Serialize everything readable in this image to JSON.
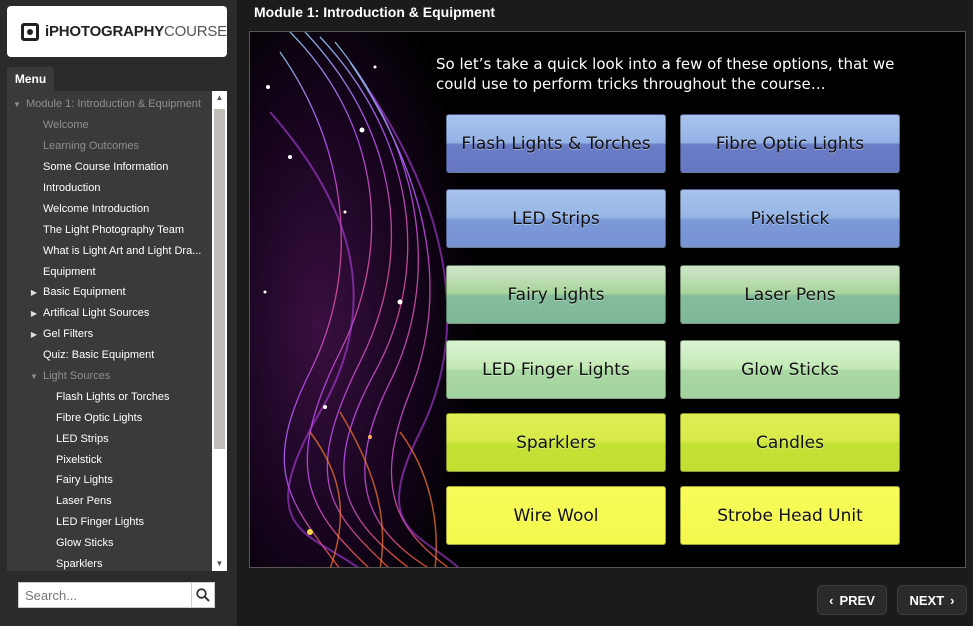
{
  "logo": {
    "bold": "iPHOTOGRAPHY",
    "light": "COURSE"
  },
  "menu": {
    "tab_label": "Menu",
    "items": [
      {
        "label": "Module 1: Introduction & Equipment",
        "level": "l0",
        "arrow": "down",
        "dim": true
      },
      {
        "label": "Welcome",
        "level": "l1",
        "dim": true
      },
      {
        "label": "Learning Outcomes",
        "level": "l1",
        "dim": true
      },
      {
        "label": "Some Course Information",
        "level": "l1"
      },
      {
        "label": "Introduction",
        "level": "l1"
      },
      {
        "label": "Welcome Introduction",
        "level": "l1"
      },
      {
        "label": "The Light Photography Team",
        "level": "l1"
      },
      {
        "label": "What is Light Art and Light Dra...",
        "level": "l1"
      },
      {
        "label": "Equipment",
        "level": "l1"
      },
      {
        "label": "Basic Equipment",
        "level": "l1a",
        "arrow": "right"
      },
      {
        "label": "Artifical Light Sources",
        "level": "l1a",
        "arrow": "right"
      },
      {
        "label": "Gel Filters",
        "level": "l1a",
        "arrow": "right"
      },
      {
        "label": "Quiz: Basic Equipment",
        "level": "l1"
      },
      {
        "label": "Light Sources",
        "level": "l1a",
        "arrow": "down",
        "dim": true
      },
      {
        "label": "Flash Lights or Torches",
        "level": "l2"
      },
      {
        "label": "Fibre Optic Lights",
        "level": "l2"
      },
      {
        "label": "LED Strips",
        "level": "l2"
      },
      {
        "label": "Pixelstick",
        "level": "l2"
      },
      {
        "label": "Fairy Lights",
        "level": "l2"
      },
      {
        "label": "Laser Pens",
        "level": "l2"
      },
      {
        "label": "LED Finger Lights",
        "level": "l2"
      },
      {
        "label": "Glow Sticks",
        "level": "l2"
      },
      {
        "label": "Sparklers",
        "level": "l2"
      }
    ]
  },
  "search": {
    "placeholder": "Search..."
  },
  "module_title": "Module 1: Introduction & Equipment",
  "slide": {
    "prompt": "So let’s take a quick look into a few of these options, that we could use to perform tricks throughout the course…",
    "options": [
      {
        "label": "Flash Lights & Torches",
        "color": "c-blue1"
      },
      {
        "label": "Fibre Optic Lights",
        "color": "c-blue1"
      },
      {
        "label": "LED Strips",
        "color": "c-blue2"
      },
      {
        "label": "Pixelstick",
        "color": "c-blue2"
      },
      {
        "label": "Fairy Lights",
        "color": "c-green1"
      },
      {
        "label": "Laser Pens",
        "color": "c-green1"
      },
      {
        "label": "LED Finger Lights",
        "color": "c-green2"
      },
      {
        "label": "Glow Sticks",
        "color": "c-green2"
      },
      {
        "label": "Sparklers",
        "color": "c-lime"
      },
      {
        "label": "Candles",
        "color": "c-lime"
      },
      {
        "label": "Wire Wool",
        "color": "c-yellow"
      },
      {
        "label": "Strobe Head Unit",
        "color": "c-yellow"
      }
    ]
  },
  "nav": {
    "prev_label": "PREV",
    "next_label": "NEXT"
  }
}
